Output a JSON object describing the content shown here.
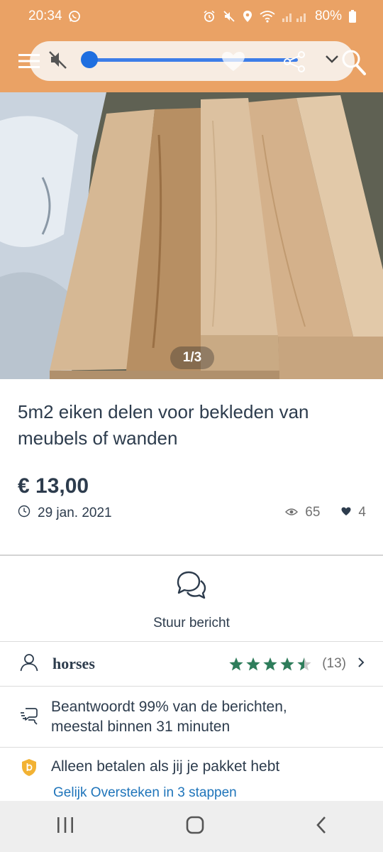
{
  "status_bar": {
    "time": "20:34",
    "battery": "80%",
    "icons": [
      "whatsapp-icon",
      "alarm-icon",
      "mute-icon",
      "location-icon",
      "wifi-icon",
      "signal-icon",
      "battery-icon"
    ]
  },
  "header": {
    "icons": [
      "hamburger-icon",
      "volume-mute-icon",
      "heart-icon",
      "share-icon",
      "chevron-down-icon",
      "search-icon"
    ],
    "media_volume_level": 0.0,
    "colors": {
      "bar": "#eaa265",
      "slider": "#1f6fe0"
    }
  },
  "listing": {
    "photo_counter": "1/3",
    "title": "5m2 eiken delen voor bekleden van meubels of wanden",
    "price": "€ 13,00",
    "date": "29 jan. 2021",
    "views": "65",
    "favorites": "4"
  },
  "actions": {
    "message_label": "Stuur bericht"
  },
  "seller": {
    "name": "horses",
    "rating": 4.5,
    "rating_max": 5,
    "review_count": "(13)",
    "star_color": "#2e7d5b"
  },
  "response": {
    "text_line1": "Beantwoordt 99% van de berichten,",
    "text_line2": "meestal binnen 31 minuten"
  },
  "payment": {
    "text": "Alleen betalen als jij je pakket hebt",
    "link": "Gelijk Oversteken in 3 stappen",
    "link_color": "#1e74ba"
  },
  "nav": {
    "icons": [
      "recent-apps-icon",
      "home-icon",
      "back-icon"
    ]
  }
}
